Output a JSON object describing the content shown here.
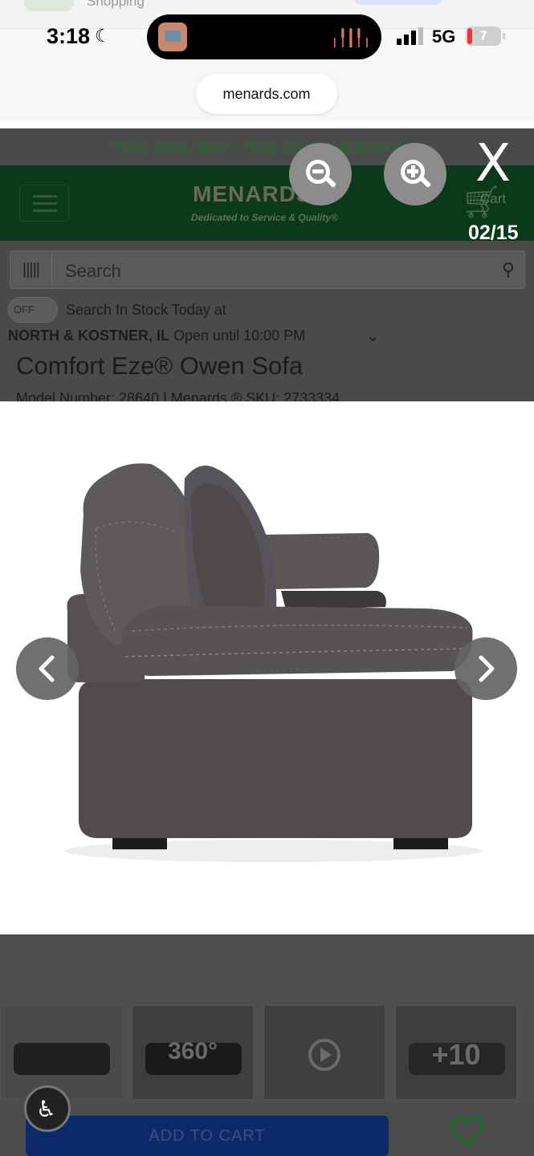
{
  "status_bar": {
    "peek_app_label": "Shopping",
    "time": "3:18",
    "network": "5G",
    "battery": "7"
  },
  "browser": {
    "url": "menards.com"
  },
  "site": {
    "promo_text": "Plant, Grow, Save – Shop Gardening Essentials",
    "logo": "MENARDS",
    "logo_tagline": "Dedicated to Service & Quality®",
    "cart_label": "Cart",
    "search_placeholder": "Search",
    "toggle_state": "OFF",
    "stock_label": "Search In Stock Today at",
    "store_name": "NORTH & KOSTNER, IL",
    "store_hours": "Open until 10:00 PM",
    "product_title": "Comfort Eze® Owen Sofa",
    "product_subtitle": "Model Number: 28640 | Menards ® SKU: 2733334"
  },
  "viewer": {
    "counter": "02/15",
    "close_label": "X",
    "thumbnails": [
      {
        "label": ""
      },
      {
        "label": "360°"
      },
      {
        "label": ""
      },
      {
        "label": "+10"
      }
    ]
  },
  "footer": {
    "add_to_cart": "ADD TO CART"
  },
  "colors": {
    "menards_green": "#0a3a1a",
    "cart_blue": "#0c2a6a",
    "heart_green": "#1f6b2a"
  }
}
